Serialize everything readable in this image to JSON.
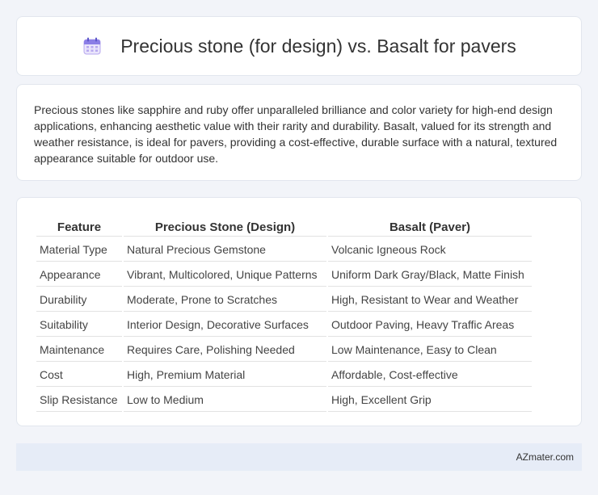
{
  "header": {
    "title": "Precious stone (for design) vs. Basalt for pavers",
    "icon": "calendar-icon"
  },
  "summary": "Precious stones like sapphire and ruby offer unparalleled brilliance and color variety for high-end design applications, enhancing aesthetic value with their rarity and durability. Basalt, valued for its strength and weather resistance, is ideal for pavers, providing a cost-effective, durable surface with a natural, textured appearance suitable for outdoor use.",
  "table": {
    "headers": [
      "Feature",
      "Precious Stone (Design)",
      "Basalt (Paver)"
    ],
    "rows": [
      [
        "Material Type",
        "Natural Precious Gemstone",
        "Volcanic Igneous Rock"
      ],
      [
        "Appearance",
        "Vibrant, Multicolored, Unique Patterns",
        "Uniform Dark Gray/Black, Matte Finish"
      ],
      [
        "Durability",
        "Moderate, Prone to Scratches",
        "High, Resistant to Wear and Weather"
      ],
      [
        "Suitability",
        "Interior Design, Decorative Surfaces",
        "Outdoor Paving, Heavy Traffic Areas"
      ],
      [
        "Maintenance",
        "Requires Care, Polishing Needed",
        "Low Maintenance, Easy to Clean"
      ],
      [
        "Cost",
        "High, Premium Material",
        "Affordable, Cost-effective"
      ],
      [
        "Slip Resistance",
        "Low to Medium",
        "High, Excellent Grip"
      ]
    ]
  },
  "footer": {
    "brand": "AZmater.com"
  }
}
